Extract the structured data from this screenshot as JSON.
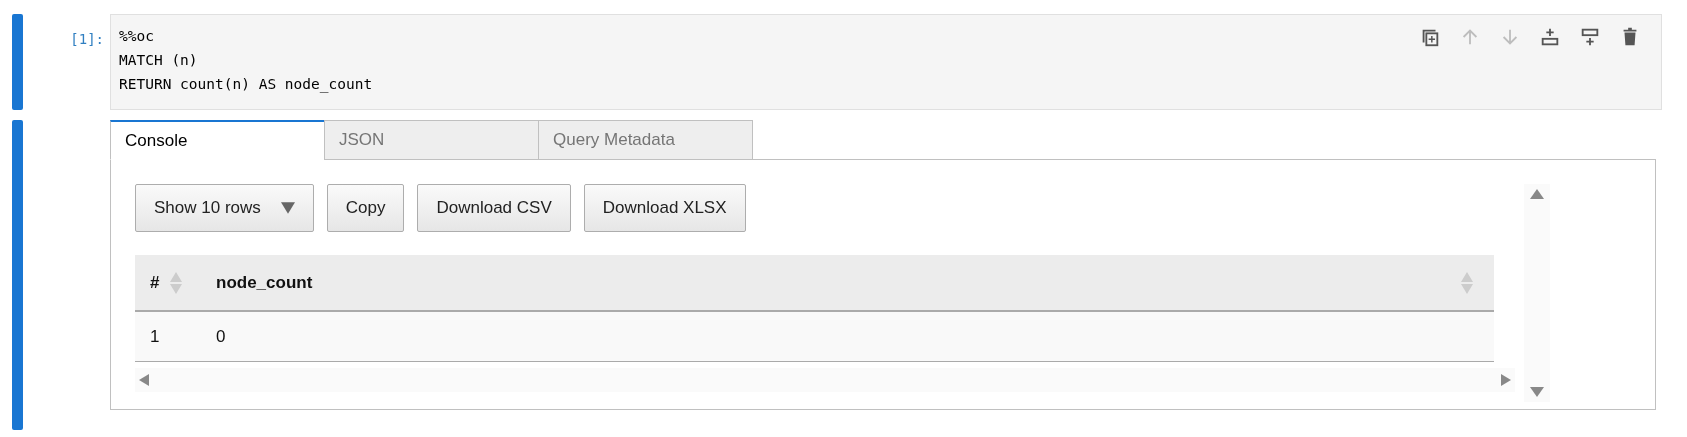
{
  "input_cell": {
    "prompt": "[1]:",
    "code_lines": [
      "%%oc",
      "MATCH (n)",
      "RETURN count(n) AS node_count"
    ],
    "toolbar": [
      {
        "kind": "duplicate",
        "disabled": false
      },
      {
        "kind": "move-up",
        "disabled": true
      },
      {
        "kind": "move-down",
        "disabled": true
      },
      {
        "kind": "insert-above",
        "disabled": false
      },
      {
        "kind": "insert-below",
        "disabled": false
      },
      {
        "kind": "delete",
        "disabled": false
      }
    ]
  },
  "output": {
    "tabs": [
      {
        "label": "Console",
        "selected": true
      },
      {
        "label": "JSON",
        "selected": false
      },
      {
        "label": "Query Metadata",
        "selected": false
      }
    ],
    "length_menu": {
      "label": "Show 10 rows"
    },
    "buttons": [
      "Copy",
      "Download CSV",
      "Download XLSX"
    ],
    "table": {
      "columns": [
        "#",
        "node_count"
      ],
      "rows": [
        [
          "1",
          "0"
        ]
      ]
    }
  }
}
